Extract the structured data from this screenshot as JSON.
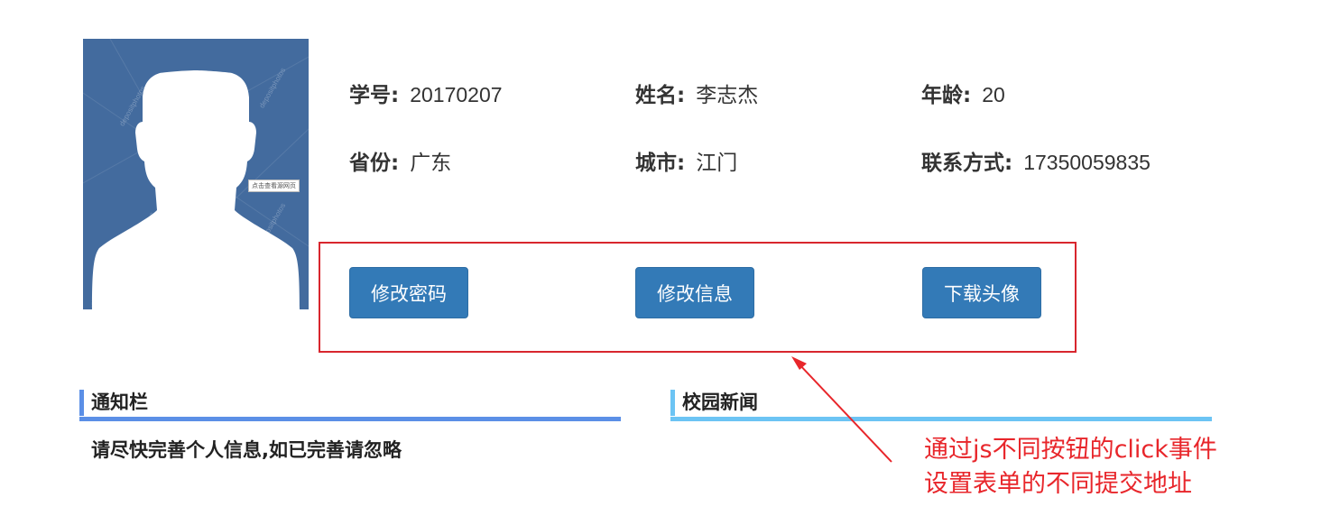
{
  "avatar": {
    "watermark_text": "depositphotos",
    "tag_label": "点击查看源网页",
    "background_color": "#436b9e"
  },
  "student": {
    "id_label": "学号:",
    "id_value": "20170207",
    "name_label": "姓名:",
    "name_value": "李志杰",
    "age_label": "年龄:",
    "age_value": "20",
    "province_label": "省份:",
    "province_value": "广东",
    "city_label": "城市:",
    "city_value": "江门",
    "contact_label": "联系方式:",
    "contact_value": "17350059835"
  },
  "actions": {
    "change_password": "修改密码",
    "edit_info": "修改信息",
    "download_avatar": "下载头像"
  },
  "notice": {
    "title": "通知栏",
    "text": "请尽快完善个人信息,如已完善请忽略",
    "accent_color": "#5b8fe6"
  },
  "news": {
    "title": "校园新闻",
    "accent_color": "#6cc4f4"
  },
  "annotation": {
    "line1": "通过js不同按钮的click事件",
    "line2": "设置表单的不同提交地址",
    "color": "#e8262b"
  }
}
